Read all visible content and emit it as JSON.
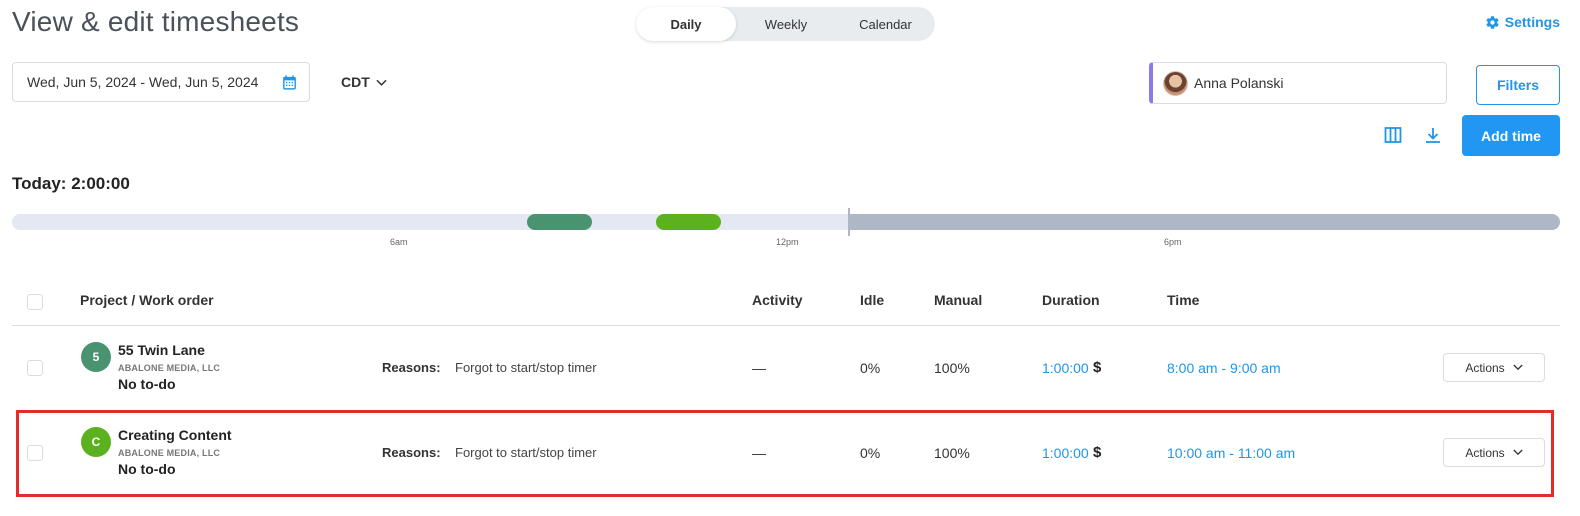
{
  "header": {
    "title": "View & edit timesheets",
    "view_tabs": [
      "Daily",
      "Weekly",
      "Calendar"
    ],
    "settings_label": "Settings"
  },
  "filters": {
    "date_range": "Wed, Jun 5, 2024 - Wed, Jun 5, 2024",
    "timezone": "CDT",
    "member": "Anna Polanski",
    "filters_label": "Filters",
    "add_time_label": "Add time"
  },
  "summary": {
    "today_label": "Today:",
    "today_total": "2:00:00"
  },
  "timeline": {
    "ticks": [
      "6am",
      "12pm",
      "6pm"
    ],
    "colors": {
      "past_track": "#e3e8f2",
      "future_track": "#adb7c5",
      "block_1": "#4a9370",
      "block_2": "#5cb21e"
    }
  },
  "table": {
    "columns": {
      "project": "Project / Work order",
      "activity": "Activity",
      "idle": "Idle",
      "manual": "Manual",
      "duration": "Duration",
      "time": "Time"
    },
    "rows": [
      {
        "avatar_letter": "5",
        "avatar_color": "#4a9370",
        "project": "55 Twin Lane",
        "client": "ABALONE MEDIA, LLC",
        "todo": "No to-do",
        "reasons_label": "Reasons:",
        "reasons": "Forgot to start/stop timer",
        "activity": "—",
        "idle": "0%",
        "manual": "100%",
        "duration": "1:00:00",
        "currency": "$",
        "time": "8:00 am - 9:00 am",
        "actions_label": "Actions"
      },
      {
        "avatar_letter": "C",
        "avatar_color": "#5cb21e",
        "project": "Creating Content",
        "client": "ABALONE MEDIA, LLC",
        "todo": "No to-do",
        "reasons_label": "Reasons:",
        "reasons": "Forgot to start/stop timer",
        "activity": "—",
        "idle": "0%",
        "manual": "100%",
        "duration": "1:00:00",
        "currency": "$",
        "time": "10:00 am - 11:00 am",
        "actions_label": "Actions"
      }
    ]
  },
  "icons": {
    "settings": "gear-icon",
    "calendar": "calendar-icon",
    "timezone_dropdown": "chevron-down-icon",
    "columns": "columns-icon",
    "download": "download-icon",
    "actions_dropdown": "chevron-down-icon"
  },
  "accent_color": "#2196e8",
  "highlight_color": "#e32b2b"
}
